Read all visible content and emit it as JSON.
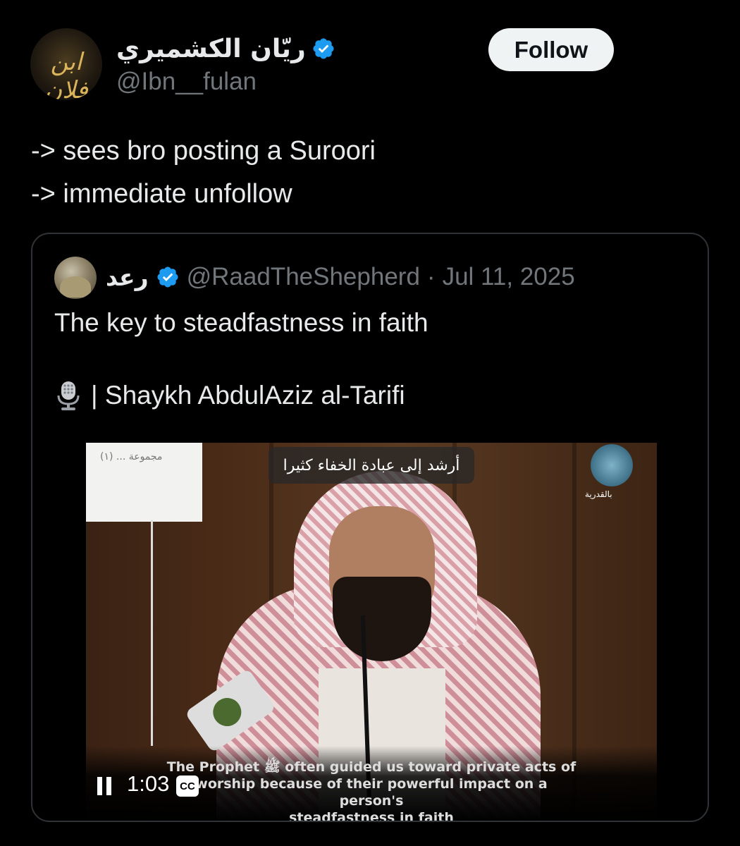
{
  "author": {
    "display_name": "ريّان الكشميري",
    "handle": "@Ibn__fulan",
    "avatar_text": "ابن فلان",
    "verified": true
  },
  "follow_label": "Follow",
  "tweet_lines": [
    "-> sees bro posting a Suroori",
    "-> immediate unfollow"
  ],
  "quote": {
    "display_name": "رعد",
    "handle": "@RaadTheShepherd",
    "separator": "·",
    "date": "Jul 11, 2025",
    "text": "The key to steadfastness in faith",
    "credit": "| Shaykh AbdulAziz al-Tarifi",
    "credit_icon": "microphone-icon",
    "verified": true
  },
  "video": {
    "caption_top": "أرشد إلى عبادة الخفاء كثيرا",
    "subtitle_lines": [
      "The Prophet ﷺ often guided us toward private acts of",
      "worship because of their powerful impact on a person's",
      "steadfastness in faith"
    ],
    "time": "1:03",
    "cc_label": "CC",
    "state": "playing"
  },
  "colors": {
    "background": "#000000",
    "text": "#e7e9ea",
    "muted": "#71767b",
    "verified_blue": "#1d9bf0",
    "border": "#2f3336",
    "follow_bg": "#eff3f4"
  }
}
